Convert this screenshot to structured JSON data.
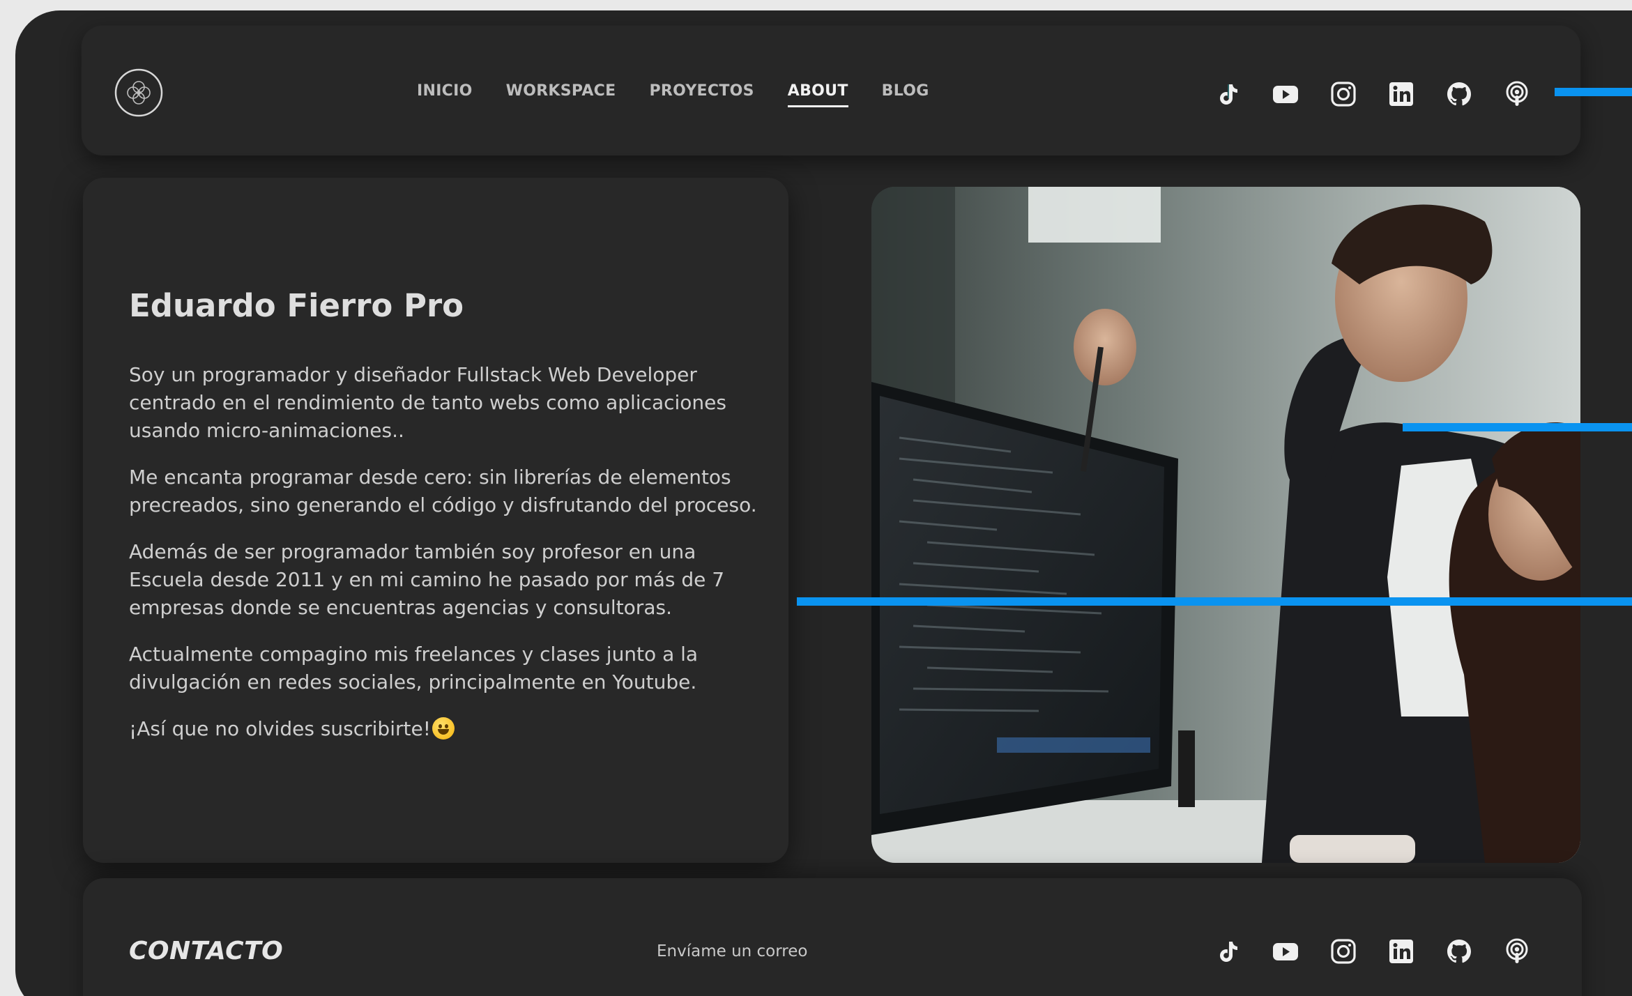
{
  "colors": {
    "background": "#252525",
    "card": "#282828",
    "accent_blue": "#0a93f0",
    "text": "#cfcfcf",
    "heading": "#dedede"
  },
  "header": {
    "logo_icon": "flower-logo-icon",
    "nav": [
      {
        "label": "INICIO",
        "active": false
      },
      {
        "label": "WORKSPACE",
        "active": false
      },
      {
        "label": "PROYECTOS",
        "active": false
      },
      {
        "label": "ABOUT",
        "active": true
      },
      {
        "label": "BLOG",
        "active": false
      }
    ],
    "socials": [
      "tiktok-icon",
      "youtube-icon",
      "instagram-icon",
      "linkedin-icon",
      "github-icon",
      "podcast-icon"
    ]
  },
  "about": {
    "title": "Eduardo Fierro Pro",
    "paragraphs": [
      "Soy un programador y diseñador Fullstack Web Developer centrado en el rendimiento de tanto webs como aplicaciones usando micro-animaciones..",
      "Me encanta programar desde cero: sin librerías de elementos precreados, sino generando el código y disfrutando del proceso.",
      "Además de ser programador también soy profesor en una Escuela desde 2011 y en mi camino he pasado por más de 7 empresas donde se encuentras agencias y consultoras.",
      "Actualmente compagino mis freelances y clases junto a la divulgación en redes sociales, principalmente en Youtube.",
      "¡Así que no olvides suscribirte!"
    ],
    "emoji": "grinning-face-emoji"
  },
  "photo": {
    "subject": "office-team-photo"
  },
  "footer": {
    "contact_title": "CONTACTO",
    "email_link": "Envíame un correo",
    "socials": [
      "tiktok-icon",
      "youtube-icon",
      "instagram-icon",
      "linkedin-icon",
      "github-icon",
      "podcast-icon"
    ]
  }
}
